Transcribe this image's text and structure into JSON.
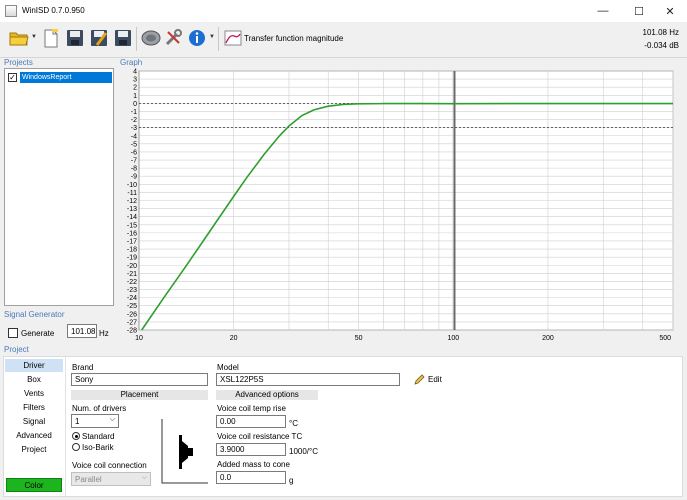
{
  "window": {
    "title": "WinISD 0.7.0.950",
    "minimize": "—",
    "maximize": "☐",
    "close": "✕"
  },
  "toolbar": {
    "graph_mode_label": "Transfer function magnitude",
    "readout_freq": "101.08 Hz",
    "readout_db": "-0.034 dB"
  },
  "projects": {
    "header": "Projects",
    "items": [
      {
        "name": "WindowsReport",
        "checked": true
      }
    ]
  },
  "graph": {
    "header": "Graph"
  },
  "signal_generator": {
    "header": "Signal Generator",
    "generate_label": "Generate",
    "frequency": "101.08",
    "unit": "Hz"
  },
  "project_panel": {
    "header": "Project",
    "tabs": [
      "Driver",
      "Box",
      "Vents",
      "Filters",
      "Signal",
      "Advanced",
      "Project"
    ],
    "active_tab": 0,
    "color_button": "Color",
    "color": "#1db51d"
  },
  "driver": {
    "brand_label": "Brand",
    "brand_value": "Sony",
    "model_label": "Model",
    "model_value": "XSL122P5S",
    "edit_label": "Edit",
    "placement_header": "Placement",
    "num_drivers_label": "Num. of drivers",
    "num_drivers_value": "1",
    "radio_standard": "Standard",
    "radio_isobarik": "Iso-Barik",
    "voice_coil_connection_label": "Voice coil connection",
    "voice_coil_connection_value": "Parallel",
    "advanced_header": "Advanced options",
    "vc_temp_label": "Voice coil temp rise",
    "vc_temp_value": "0.00",
    "vc_temp_unit": "°C",
    "vc_res_label": "Voice coil resistance TC",
    "vc_res_value": "3.9000",
    "vc_res_unit": "1000/°C",
    "mass_label": "Added mass to cone",
    "mass_value": "0.0",
    "mass_unit": "g"
  },
  "chart_data": {
    "type": "line",
    "x_scale": "log",
    "xlim": [
      10,
      500
    ],
    "ylim": [
      -28,
      4
    ],
    "x_ticks": [
      "10",
      "20",
      "50",
      "100",
      "200",
      "500"
    ],
    "x_tick_values": [
      10,
      20,
      50,
      100,
      200,
      500
    ],
    "y_ticks": [
      "4",
      "3",
      "2",
      "1",
      "0",
      "-1",
      "-2",
      "-3",
      "-4",
      "-5",
      "-6",
      "-7",
      "-8",
      "-9",
      "-10",
      "-11",
      "-12",
      "-13",
      "-14",
      "-15",
      "-16",
      "-17",
      "-18",
      "-19",
      "-20",
      "-21",
      "-22",
      "-23",
      "-24",
      "-25",
      "-26",
      "-27",
      "-28"
    ],
    "grid": true,
    "cursor_x": 101.08,
    "reference_lines": [
      0,
      -3
    ],
    "series": [
      {
        "color": "#2e9e2e",
        "x": [
          10.2,
          12,
          14,
          16,
          18,
          20,
          22,
          25,
          28,
          30,
          33,
          36,
          40,
          45,
          50,
          60,
          70,
          80,
          100,
          150,
          200,
          300,
          500
        ],
        "y": [
          -28,
          -24,
          -20.3,
          -17,
          -14.1,
          -11.5,
          -9.2,
          -6.3,
          -4,
          -2.8,
          -1.5,
          -0.8,
          -0.35,
          -0.12,
          -0.05,
          -0.03,
          -0.03,
          -0.03,
          -0.034,
          -0.03,
          -0.03,
          -0.03,
          -0.03
        ]
      }
    ]
  }
}
